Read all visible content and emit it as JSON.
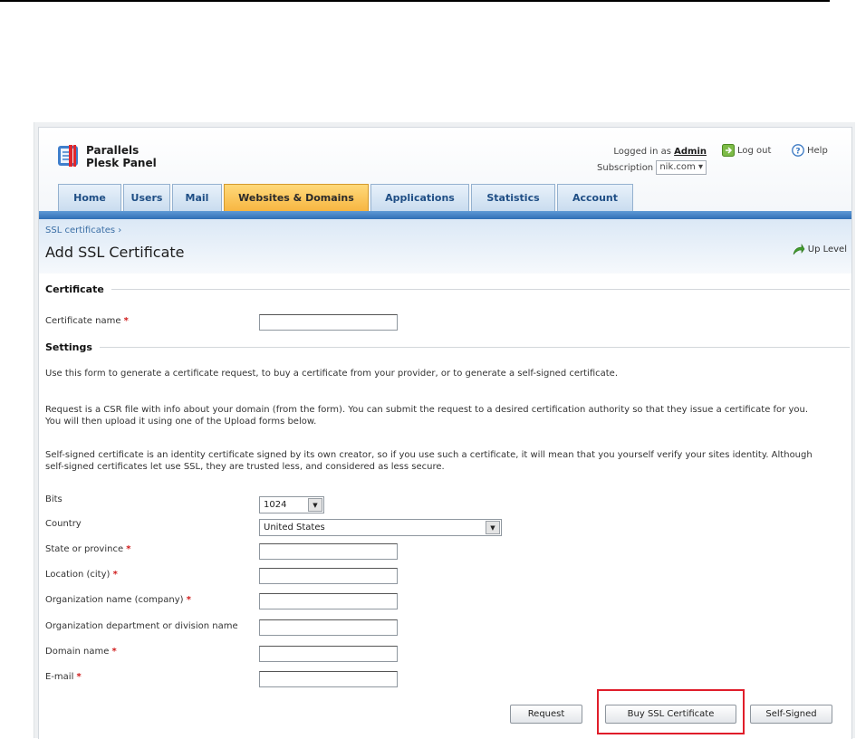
{
  "brand": {
    "line1": "Parallels",
    "line2": "Plesk Panel"
  },
  "session": {
    "logged_in_label": "Logged in as",
    "user": "Admin",
    "subscription_label": "Subscription",
    "subscription_value": "nik.com"
  },
  "header_actions": {
    "logout": "Log out",
    "help": "Help"
  },
  "tabs": [
    {
      "label": "Home"
    },
    {
      "label": "Users"
    },
    {
      "label": "Mail"
    },
    {
      "label": "Websites & Domains",
      "active": true
    },
    {
      "label": "Applications"
    },
    {
      "label": "Statistics"
    },
    {
      "label": "Account"
    }
  ],
  "breadcrumb": "SSL certificates ›",
  "page_title": "Add SSL Certificate",
  "up_level": "Up Level",
  "sections": {
    "certificate": "Certificate",
    "settings": "Settings"
  },
  "fields": {
    "certificate_name": {
      "label": "Certificate name",
      "value": ""
    },
    "bits": {
      "label": "Bits",
      "value": "1024"
    },
    "country": {
      "label": "Country",
      "value": "United States"
    },
    "state": {
      "label": "State or province",
      "value": ""
    },
    "city": {
      "label": "Location (city)",
      "value": ""
    },
    "organization": {
      "label": "Organization name (company)",
      "value": ""
    },
    "department": {
      "label": "Organization department or division name",
      "value": ""
    },
    "domain": {
      "label": "Domain name",
      "value": ""
    },
    "email": {
      "label": "E-mail",
      "value": ""
    }
  },
  "required_mark": "*",
  "paragraphs": {
    "p1": "Use this form to generate a certificate request, to buy a certificate from your provider, or to generate a self-signed certificate.",
    "p2a": "Request is a CSR file with info about your domain (from the form). You can submit the request to a desired certification authority so that they issue a certificate for you.",
    "p2b": "You will then upload it using one of the Upload forms below.",
    "p3a": "Self-signed certificate is an identity certificate signed by its own creator, so if you use such a certificate, it will mean that you yourself verify your sites identity. Although",
    "p3b": "self-signed certificates let use SSL, they are trusted less, and considered as less secure."
  },
  "buttons": {
    "request": "Request",
    "buy": "Buy SSL Certificate",
    "self_signed": "Self-Signed"
  },
  "colors": {
    "active_tab": "#f7b642",
    "tab_blue": "#2f6fb6",
    "highlight": "#e01d2a",
    "required": "#d01c1c"
  }
}
